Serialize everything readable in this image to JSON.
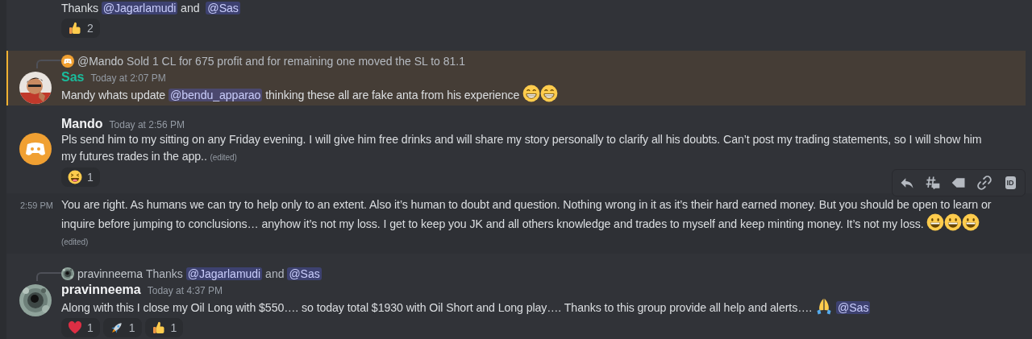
{
  "messages": [
    {
      "kind": "continuation",
      "highlighted": false,
      "hovered": false,
      "content": [
        {
          "kind": "text",
          "text": "Thanks "
        },
        {
          "kind": "mention",
          "text": "@Jagarlamudi"
        },
        {
          "kind": "text",
          "text": " and "
        },
        {
          "kind": "mention",
          "text": "@Sas"
        }
      ],
      "reactions": [
        {
          "kind": "thumbs_up",
          "count": "2"
        }
      ]
    },
    {
      "kind": "message",
      "highlighted": true,
      "hovered": false,
      "reply": {
        "avatar": {
          "kind": "bot"
        },
        "author": "@Mando",
        "content": [
          {
            "kind": "text",
            "text": "Sold 1 CL for 675 profit and for remaining one moved the SL to 81.1"
          }
        ]
      },
      "author": "Sas",
      "color": "#1abc9c",
      "time": "Today at 2:07 PM",
      "content": [
        {
          "kind": "text",
          "text": "Mandy whats update "
        },
        {
          "kind": "mention",
          "text": "@bendu_apparao"
        },
        {
          "kind": "text",
          "text": " thinking these all are fake anta from his experience "
        },
        {
          "kind": "grin"
        },
        {
          "kind": "grin"
        }
      ]
    },
    {
      "kind": "message",
      "highlighted": false,
      "hovered": false,
      "avatar": {
        "kind": "bot"
      },
      "author": "Mando",
      "color": "#f2f3f5",
      "time": "Today at 2:56 PM",
      "content": [
        {
          "kind": "text",
          "text": "Pls send him to my sitting on any Friday evening. I will give him free drinks and will share my story personally to clarify all his doubts. Can’t post my trading statements, so I will show him my futures trades in the app.."
        }
      ],
      "edited": "(edited)",
      "reactions": [
        {
          "kind": "laugh",
          "count": "1"
        }
      ]
    },
    {
      "kind": "continuation",
      "highlighted": false,
      "hovered": true,
      "time": "2:59 PM",
      "content": [
        {
          "kind": "text",
          "text": "You are right. As humans we can try to help only to an extent. Also it’s human to doubt and question. Nothing wrong in it as it’s their hard earned money. But you should be open to learn or inquire before jumping to conclusions… anyhow it’s not my loss. I get to keep you JK and all others knowledge and trades to myself and keep minting money. It’s not my loss. "
        },
        {
          "kind": "smile"
        },
        {
          "kind": "smile"
        },
        {
          "kind": "smile"
        }
      ],
      "edited": "(edited)",
      "toolbar": [
        {
          "kind": "reply"
        },
        {
          "kind": "thread"
        },
        {
          "kind": "tag"
        },
        {
          "kind": "link"
        },
        {
          "kind": "id",
          "label": "ID"
        }
      ]
    },
    {
      "kind": "message",
      "highlighted": false,
      "hovered": false,
      "reply": {
        "avatar": {
          "kind": "texture"
        },
        "author": "pravinneema",
        "content": [
          {
            "kind": "text",
            "text": "Thanks "
          },
          {
            "kind": "mention",
            "text": "@Jagarlamudi"
          },
          {
            "kind": "text",
            "text": " and "
          },
          {
            "kind": "mention",
            "text": "@Sas"
          }
        ]
      },
      "avatar": {
        "kind": "texture"
      },
      "author": "pravinneema",
      "color": "#f2f3f5",
      "time": "Today at 4:37 PM",
      "content": [
        {
          "kind": "text",
          "text": "Along with this I close my Oil Long with $550…. so today total $1930 with Oil Short and Long play…. Thanks to this group provide all help and alerts…. "
        },
        {
          "kind": "pray"
        },
        {
          "kind": "mention",
          "text": "@Sas"
        }
      ],
      "reactions": [
        {
          "kind": "heart",
          "count": "1"
        },
        {
          "kind": "rocket",
          "count": "1"
        },
        {
          "kind": "thumbs_up",
          "count": "1"
        }
      ]
    }
  ]
}
